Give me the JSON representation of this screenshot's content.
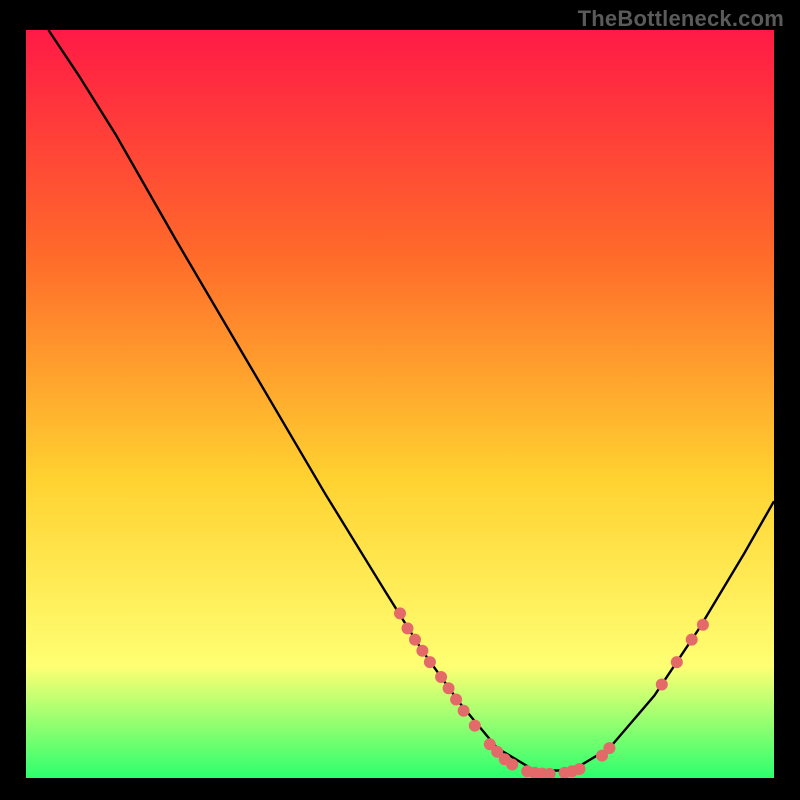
{
  "watermark": "TheBottleneck.com",
  "colors": {
    "background": "#000000",
    "gradient_top": "#ff1a46",
    "gradient_mid1": "#ff6a2a",
    "gradient_mid2": "#ffd230",
    "gradient_mid3": "#ffff73",
    "gradient_bottom": "#2cff6e",
    "curve": "#000000",
    "markers": "#e46a6a",
    "watermark": "#5a5a5a"
  },
  "chart_data": {
    "type": "line",
    "title": "",
    "xlabel": "",
    "ylabel": "",
    "xlim": [
      0,
      100
    ],
    "ylim": [
      0,
      100
    ],
    "grid": false,
    "legend": false,
    "curve": [
      {
        "x": 3,
        "y": 100
      },
      {
        "x": 7,
        "y": 94
      },
      {
        "x": 12,
        "y": 86
      },
      {
        "x": 20,
        "y": 72
      },
      {
        "x": 30,
        "y": 55
      },
      {
        "x": 40,
        "y": 38
      },
      {
        "x": 48,
        "y": 25
      },
      {
        "x": 53,
        "y": 17
      },
      {
        "x": 58,
        "y": 10
      },
      {
        "x": 63,
        "y": 4
      },
      {
        "x": 68,
        "y": 1
      },
      {
        "x": 73,
        "y": 1
      },
      {
        "x": 78,
        "y": 4
      },
      {
        "x": 84,
        "y": 11
      },
      {
        "x": 90,
        "y": 20
      },
      {
        "x": 96,
        "y": 30
      },
      {
        "x": 100,
        "y": 37
      }
    ],
    "markers": [
      {
        "x": 50,
        "y": 22
      },
      {
        "x": 51,
        "y": 20
      },
      {
        "x": 52,
        "y": 18.5
      },
      {
        "x": 53,
        "y": 17
      },
      {
        "x": 54,
        "y": 15.5
      },
      {
        "x": 55.5,
        "y": 13.5
      },
      {
        "x": 56.5,
        "y": 12
      },
      {
        "x": 57.5,
        "y": 10.5
      },
      {
        "x": 58.5,
        "y": 9
      },
      {
        "x": 60,
        "y": 7
      },
      {
        "x": 62,
        "y": 4.5
      },
      {
        "x": 63,
        "y": 3.5
      },
      {
        "x": 64,
        "y": 2.5
      },
      {
        "x": 65,
        "y": 1.8
      },
      {
        "x": 67,
        "y": 0.9
      },
      {
        "x": 68,
        "y": 0.7
      },
      {
        "x": 69,
        "y": 0.6
      },
      {
        "x": 70,
        "y": 0.55
      },
      {
        "x": 72,
        "y": 0.7
      },
      {
        "x": 73,
        "y": 0.9
      },
      {
        "x": 74,
        "y": 1.2
      },
      {
        "x": 77,
        "y": 3
      },
      {
        "x": 78,
        "y": 4
      },
      {
        "x": 85,
        "y": 12.5
      },
      {
        "x": 87,
        "y": 15.5
      },
      {
        "x": 89,
        "y": 18.5
      },
      {
        "x": 90.5,
        "y": 20.5
      }
    ],
    "flat_band": {
      "y0_pct": 97,
      "y1_pct": 100
    }
  }
}
